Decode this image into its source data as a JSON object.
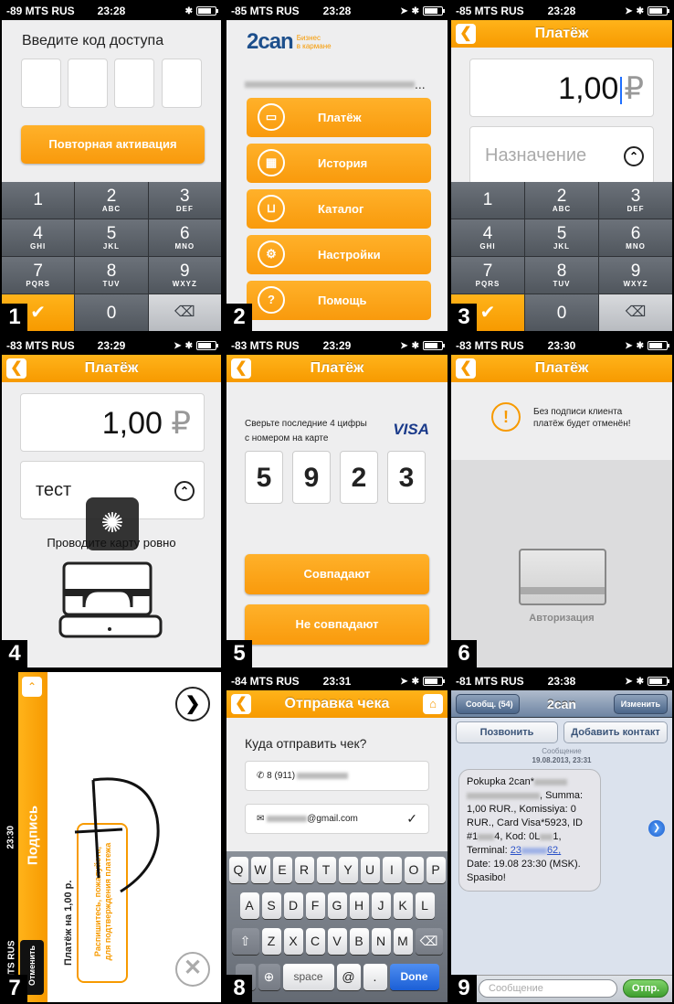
{
  "p1": {
    "num": "1",
    "carrier": "-89 MTS RUS",
    "time": "23:28",
    "title": "Введите код доступа",
    "button": "Повторная активация",
    "keys": [
      {
        "d": "1",
        "l": ""
      },
      {
        "d": "2",
        "l": "ABC"
      },
      {
        "d": "3",
        "l": "DEF"
      },
      {
        "d": "4",
        "l": "GHI"
      },
      {
        "d": "5",
        "l": "JKL"
      },
      {
        "d": "6",
        "l": "MNO"
      },
      {
        "d": "7",
        "l": "PQRS"
      },
      {
        "d": "8",
        "l": "TUV"
      },
      {
        "d": "9",
        "l": "WXYZ"
      }
    ],
    "zero": "0"
  },
  "p2": {
    "num": "2",
    "carrier": "-85 MTS RUS",
    "time": "23:28",
    "logo": "2can",
    "slogan1": "Бизнес",
    "slogan2": "в кармане",
    "dots": "...",
    "menu": [
      "Платёж",
      "История",
      "Каталог",
      "Настройки",
      "Помощь"
    ],
    "help_icon": "?"
  },
  "p3": {
    "num": "3",
    "carrier": "-85 MTS RUS",
    "time": "23:28",
    "title": "Платёж",
    "amount": "1,00",
    "currency": "₽",
    "purpose_placeholder": "Назначение",
    "zero": "0"
  },
  "p4": {
    "num": "4",
    "carrier": "-83 MTS RUS",
    "time": "23:29",
    "title": "Платёж",
    "amount": "1,00",
    "currency": "₽",
    "purpose": "тест",
    "hint": "Проводите карту ровно"
  },
  "p5": {
    "num": "5",
    "carrier": "-83 MTS RUS",
    "time": "23:29",
    "title": "Платёж",
    "text1": "Сверьте последние 4 цифры",
    "text2": "с номером на карте",
    "visa": "VISA",
    "digits": [
      "5",
      "9",
      "2",
      "3"
    ],
    "match": "Совпадают",
    "nomatch": "Не совпадают"
  },
  "p6": {
    "num": "6",
    "carrier": "-83 MTS RUS",
    "time": "23:30",
    "title": "Платёж",
    "warn_icon": "!",
    "warn1": "Без подписи клиента",
    "warn2": "платёж будет отменён!",
    "auth": "Авторизация"
  },
  "p7": {
    "num": "7",
    "carrier": "MTS RUS",
    "time": "23:30",
    "title": "Подпись",
    "cancel": "Отменить",
    "amount": "Платёж на 1,00 р.",
    "sign1": "Распишитесь, пожалуйста,",
    "sign2": "для подтверждения платежа"
  },
  "p8": {
    "num": "8",
    "carrier": "-84 MTS RUS",
    "time": "23:31",
    "title": "Отправка чека",
    "question": "Куда отправить чек?",
    "phone": "8 (911)",
    "email": "@gmail.com",
    "row1": [
      "Q",
      "W",
      "E",
      "R",
      "T",
      "Y",
      "U",
      "I",
      "O",
      "P"
    ],
    "row2": [
      "A",
      "S",
      "D",
      "F",
      "G",
      "H",
      "J",
      "K",
      "L"
    ],
    "row3": [
      "Z",
      "X",
      "C",
      "V",
      "B",
      "N",
      "M"
    ],
    "space": "space",
    "at": "@",
    "dot": ".",
    "done": "Done"
  },
  "p9": {
    "num": "9",
    "carrier": "-81 MTS RUS",
    "time": "23:38",
    "back": "Сообщ. (54)",
    "title": "2can",
    "edit": "Изменить",
    "call": "Позвонить",
    "add": "Добавить контакт",
    "msg_label": "Сообщение",
    "date": "19.08.2013, 23:31",
    "l1": "Pokupka 2can*",
    "l2": ", Summa:",
    "l3": "1,00 RUR., Komissiya: 0",
    "l4": "RUR., Card Visa*5923, ID",
    "l5a": "#1",
    "l5b": "4, Kod: 0L",
    "l5c": "1,",
    "l6a": "Terminal: ",
    "l6b": "23",
    "l6c": "62,",
    "l7": "Date: 19.08 23:30 (MSK).",
    "l8": "Spasibo!",
    "input_placeholder": "Сообщение",
    "send": "Отпр."
  }
}
